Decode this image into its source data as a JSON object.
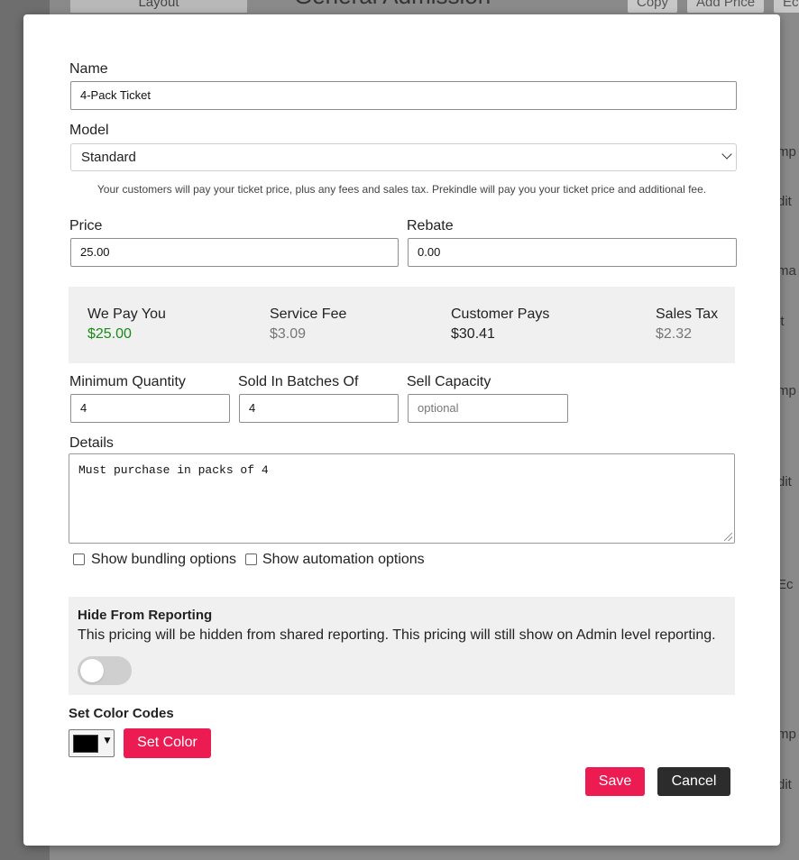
{
  "background": {
    "sidebar_tab": "Layout",
    "page_title": "General Admission",
    "buttons": [
      "Copy",
      "Add Price",
      "Ec"
    ],
    "right_edge_fragments": [
      "mp",
      "dit",
      "ma",
      "it",
      "mp",
      "dit",
      "Ec",
      "mp",
      "dit"
    ]
  },
  "form": {
    "name_label": "Name",
    "name_value": "4-Pack Ticket",
    "model_label": "Model",
    "model_value": "Standard",
    "model_helper": "Your customers will pay your ticket price, plus any fees and sales tax. Prekindle will pay you your ticket price and additional fee.",
    "price_label": "Price",
    "price_value": "25.00",
    "rebate_label": "Rebate",
    "rebate_value": "0.00",
    "summary": {
      "we_pay_you_label": "We Pay You",
      "we_pay_you_value": "$25.00",
      "service_fee_label": "Service Fee",
      "service_fee_value": "$3.09",
      "customer_pays_label": "Customer Pays",
      "customer_pays_value": "$30.41",
      "sales_tax_label": "Sales Tax",
      "sales_tax_value": "$2.32"
    },
    "min_qty_label": "Minimum Quantity",
    "min_qty_value": "4",
    "batches_label": "Sold In Batches Of",
    "batches_value": "4",
    "capacity_label": "Sell Capacity",
    "capacity_placeholder": "optional",
    "details_label": "Details",
    "details_value": "Must purchase in packs of 4",
    "show_bundling_label": "Show bundling options",
    "show_automation_label": "Show automation options",
    "show_bundling_checked": false,
    "show_automation_checked": false,
    "hide_reporting_title": "Hide From Reporting",
    "hide_reporting_desc": "This pricing will be hidden from shared reporting. This pricing will still show on Admin level reporting.",
    "hide_reporting_on": false,
    "color_codes_title": "Set Color Codes",
    "selected_color": "#000000",
    "set_color_label": "Set Color",
    "save_label": "Save",
    "cancel_label": "Cancel"
  },
  "colors": {
    "accent": "#ec1b52",
    "dark_button": "#2c2c2c",
    "positive": "#1a8a1a",
    "muted": "#777777",
    "panel": "#f0f0f0"
  }
}
